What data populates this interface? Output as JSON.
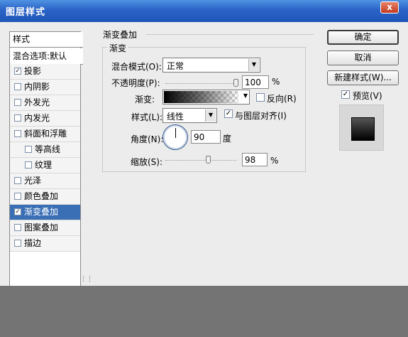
{
  "window": {
    "title": "图层样式",
    "close_label": "x"
  },
  "sidebar": {
    "header": "样式",
    "blend_default": "混合选项:默认",
    "items": [
      {
        "label": "投影",
        "checked": true
      },
      {
        "label": "内阴影",
        "checked": false
      },
      {
        "label": "外发光",
        "checked": false
      },
      {
        "label": "内发光",
        "checked": false
      },
      {
        "label": "斜面和浮雕",
        "checked": false
      },
      {
        "label": "等高线",
        "checked": false
      },
      {
        "label": "纹理",
        "checked": false
      },
      {
        "label": "光泽",
        "checked": false
      },
      {
        "label": "颜色叠加",
        "checked": false
      },
      {
        "label": "渐变叠加",
        "checked": true,
        "selected": true
      },
      {
        "label": "图案叠加",
        "checked": false
      },
      {
        "label": "描边",
        "checked": false
      }
    ]
  },
  "panel": {
    "section_title": "渐变叠加",
    "group_title": "渐变",
    "blend_mode": {
      "label": "混合模式(O):",
      "value": "正常"
    },
    "opacity": {
      "label": "不透明度(P):",
      "value": "100",
      "unit": "%",
      "percent": 100
    },
    "gradient": {
      "label": "渐变:",
      "reverse_label": "反向(R)",
      "reverse_checked": false
    },
    "style": {
      "label": "样式(L):",
      "value": "线性",
      "align_label": "与图层对齐(I)",
      "align_checked": true
    },
    "angle": {
      "label": "角度(N):",
      "value": "90",
      "unit": "度"
    },
    "scale": {
      "label": "缩放(S):",
      "value": "98",
      "unit": "%",
      "percent": 98
    }
  },
  "buttons": {
    "ok": "确定",
    "cancel": "取消",
    "new_style": "新建样式(W)...",
    "preview_label": "预览(V)",
    "preview_checked": true
  },
  "colors": {
    "titlebar": "#2a63c6",
    "selected_item": "#3b6fb5",
    "dialog_bg": "#ececec",
    "outside_bg": "#747474"
  }
}
